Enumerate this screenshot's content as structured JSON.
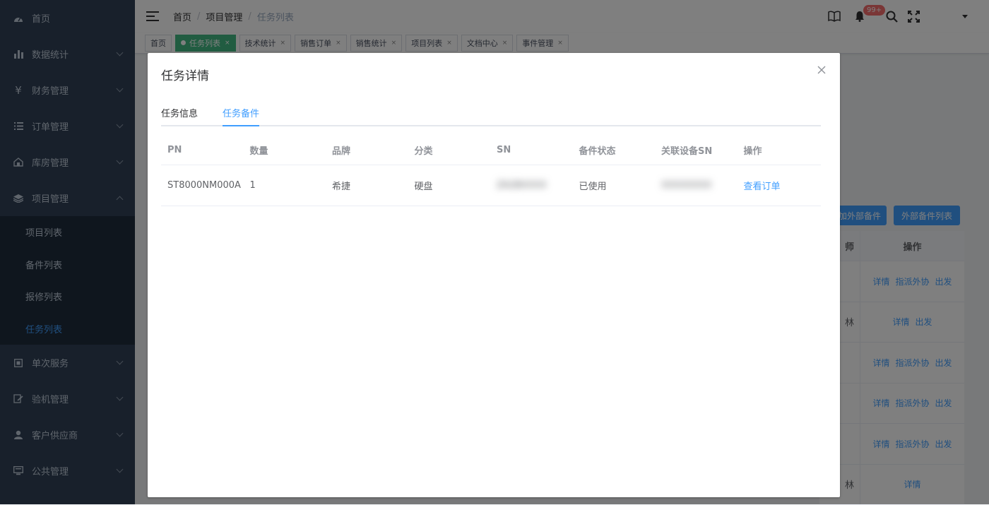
{
  "sidebar": {
    "items": [
      {
        "label": "首页",
        "icon": "dashboard-icon",
        "has_children": false
      },
      {
        "label": "数据统计",
        "icon": "bar-chart-icon",
        "has_children": true
      },
      {
        "label": "财务管理",
        "icon": "yen-icon",
        "has_children": true
      },
      {
        "label": "订单管理",
        "icon": "list-icon",
        "has_children": true
      },
      {
        "label": "库房管理",
        "icon": "warehouse-icon",
        "has_children": true
      },
      {
        "label": "项目管理",
        "icon": "layers-icon",
        "has_children": true,
        "expanded": true
      },
      {
        "label": "单次服务",
        "icon": "service-icon",
        "has_children": true
      },
      {
        "label": "验机管理",
        "icon": "inspection-icon",
        "has_children": true
      },
      {
        "label": "客户供应商",
        "icon": "user-icon",
        "has_children": true
      },
      {
        "label": "公共管理",
        "icon": "monitor-icon",
        "has_children": true
      }
    ],
    "project_submenu": [
      {
        "label": "项目列表"
      },
      {
        "label": "备件列表"
      },
      {
        "label": "报修列表"
      },
      {
        "label": "任务列表",
        "active": true
      }
    ]
  },
  "header": {
    "breadcrumb": [
      "首页",
      "项目管理",
      "任务列表"
    ],
    "notification_badge": "99+"
  },
  "tags": [
    {
      "label": "首页",
      "active": false,
      "closable": false
    },
    {
      "label": "任务列表",
      "active": true,
      "closable": true
    },
    {
      "label": "技术统计",
      "active": false,
      "closable": true
    },
    {
      "label": "销售订单",
      "active": false,
      "closable": true
    },
    {
      "label": "销售统计",
      "active": false,
      "closable": true
    },
    {
      "label": "项目列表",
      "active": false,
      "closable": true
    },
    {
      "label": "文档中心",
      "active": false,
      "closable": true
    },
    {
      "label": "事件管理",
      "active": false,
      "closable": true
    }
  ],
  "background": {
    "buttons": {
      "add_external": "加外部备件",
      "external_list": "外部备件列表"
    },
    "table_headers": {
      "left_partial": "师",
      "ops": "操作"
    },
    "rows": [
      {
        "left": "",
        "ops": [
          "详情",
          "指派外协",
          "出发"
        ]
      },
      {
        "left": "林",
        "ops": [
          "详情",
          "出发"
        ]
      },
      {
        "left": "",
        "ops": [
          "详情",
          "指派外协",
          "出发"
        ]
      },
      {
        "left": "",
        "ops": [
          "详情",
          "指派外协",
          "出发"
        ]
      },
      {
        "left": "",
        "ops": [
          "详情",
          "指派外协",
          "出发"
        ]
      },
      {
        "left": "林",
        "ops": [
          "详情"
        ]
      }
    ]
  },
  "dialog": {
    "title": "任务详情",
    "tabs": [
      {
        "label": "任务信息",
        "active": false
      },
      {
        "label": "任务备件",
        "active": true
      }
    ],
    "table": {
      "headers": [
        "PN",
        "数量",
        "品牌",
        "分类",
        "SN",
        "备件状态",
        "关联设备SN",
        "操作"
      ],
      "rows": [
        {
          "pn": "ST8000NM000A",
          "qty": "1",
          "brand": "希捷",
          "category": "硬盘",
          "sn": "ZA2BXXXX",
          "status": "已使用",
          "device_sn": "XXXXXXXX",
          "action": "查看订单"
        }
      ]
    }
  },
  "colors": {
    "sidebar_bg": "#304156",
    "submenu_bg": "#1f2d3d",
    "accent": "#409eff",
    "active_tag": "#42b983",
    "badge": "#f56c6c"
  }
}
